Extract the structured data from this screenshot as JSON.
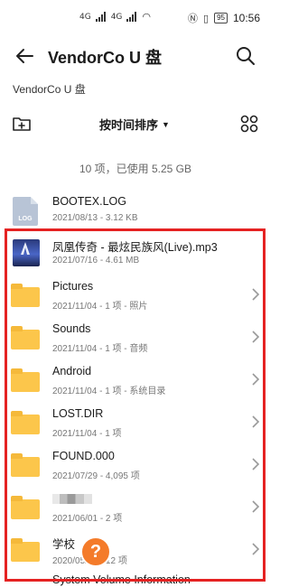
{
  "status_bar": {
    "sim_labels": [
      "4G",
      "4G"
    ],
    "battery": "95",
    "time": "10:56"
  },
  "header": {
    "title": "VendorCo U 盘"
  },
  "breadcrumb": "VendorCo U 盘",
  "toolbar": {
    "sort_label": "按时间排序"
  },
  "summary": "10 项，已使用 5.25 GB",
  "files": [
    {
      "name": "BOOTEX.LOG",
      "meta": "2021/08/13 - 3.12 KB",
      "icon": "log-file-icon",
      "icon_label": "LOG"
    },
    {
      "name": "凤凰传奇 - 最炫民族风(Live).mp3",
      "meta": "2021/07/16 - 4.61 MB",
      "icon": "album-art-icon"
    },
    {
      "name": "Pictures",
      "meta": "2021/11/04 - 1 项 - 照片",
      "icon": "folder-icon"
    },
    {
      "name": "Sounds",
      "meta": "2021/11/04 - 1 项 - 音频",
      "icon": "folder-icon"
    },
    {
      "name": "Android",
      "meta": "2021/11/04 - 1 项 - 系统目录",
      "icon": "folder-icon"
    },
    {
      "name": "LOST.DIR",
      "meta": "2021/11/04 - 1 项",
      "icon": "folder-icon"
    },
    {
      "name": "FOUND.000",
      "meta": "2021/07/29 - 4,095 项",
      "icon": "folder-icon"
    },
    {
      "name": "",
      "meta": "2021/06/01 - 2 项",
      "icon": "folder-icon"
    },
    {
      "name": "学校",
      "meta": "2020/05/01 - 12 项",
      "icon": "folder-icon"
    },
    {
      "name": "System Volume Information",
      "meta": "",
      "icon": "folder-icon"
    }
  ],
  "fab_icon": "question-icon",
  "colors": {
    "folder": "#fcc64b",
    "highlight": "#e52222",
    "fab": "#f47b2a"
  }
}
